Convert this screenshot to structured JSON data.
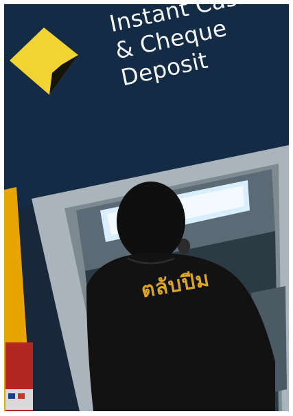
{
  "sign": {
    "line1": "Instant Cash",
    "line2": "& Cheque",
    "line3": "Deposit"
  },
  "shirt_text": "ตลับปีม",
  "colors": {
    "sign_panel": "#142b45",
    "logo_yellow": "#f1d431",
    "atm_frame": "#a9b4bc",
    "screen_glow": "#d9eeff",
    "shirt": "#121212",
    "shirt_print": "#d8a52a"
  }
}
